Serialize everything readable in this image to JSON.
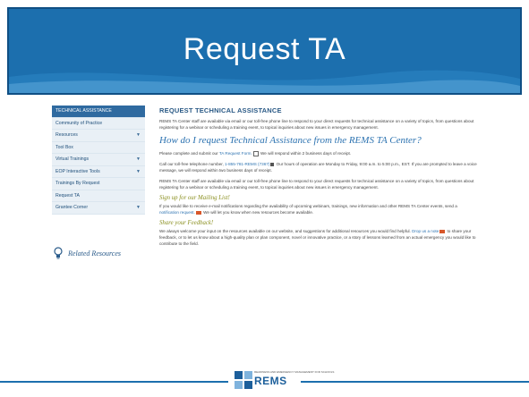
{
  "slide": {
    "title": "Request TA",
    "colors": {
      "header": "#1c6fae",
      "accent": "#2d73b1",
      "subhead": "#8a8f1f"
    }
  },
  "sidebar": {
    "items": [
      {
        "label": "TECHNICAL ASSISTANCE",
        "active": true,
        "has_submenu": false
      },
      {
        "label": "Community of Practice",
        "active": false,
        "has_submenu": false
      },
      {
        "label": "Resources",
        "active": false,
        "has_submenu": true
      },
      {
        "label": "Tool Box",
        "active": false,
        "has_submenu": false
      },
      {
        "label": "Virtual Trainings",
        "active": false,
        "has_submenu": true
      },
      {
        "label": "EOP Interactive Tools",
        "active": false,
        "has_submenu": true
      },
      {
        "label": "Trainings By Request",
        "active": false,
        "has_submenu": false
      },
      {
        "label": "Request TA",
        "active": false,
        "has_submenu": false
      },
      {
        "label": "Grantee Corner",
        "active": false,
        "has_submenu": true
      }
    ],
    "caret": "▼",
    "related_label": "Related Resources"
  },
  "content": {
    "heading": "REQUEST TECHNICAL ASSISTANCE",
    "intro": "REMS TA Center staff are available via email or our toll-free phone line to respond to your direct requests for technical assistance on a variety of topics, from questions about registering for a webinar or scheduling a training event, to topical inquiries about new issues in emergency management.",
    "how_heading": "How do I request Technical Assistance from the REMS TA Center?",
    "form_pre": "Please complete and submit our ",
    "form_link": "TA Request Form.",
    "form_post": " We will respond within 2 business days of receipt.",
    "call_pre": "Call our toll-free telephone number, ",
    "call_link": "1-855-781-REMS (7367)",
    "call_post": " Our hours of operation are Monday to Friday, 9:00 a.m. to 5:00 p.m., EST. If you are prompted to leave a voice message, we will respond within two business days of receipt.",
    "intro2": "REMS TA Center staff are available via email or our toll-free phone line to respond to your direct requests for technical assistance on a variety of topics, from questions about registering for a webinar or scheduling a training event, to topical inquiries about new issues in emergency management.",
    "mailing_heading": "Sign up for our Mailing List!",
    "mailing_pre": "If you would like to receive e-mail notifications regarding the availability of upcoming webinars, trainings, new information and other REMS TA Center events, send a ",
    "mailing_link": "notification request.",
    "mailing_post": " We will let you know when new resources become available.",
    "feedback_heading": "Share your Feedback!",
    "feedback_pre": "We always welcome your input on the resources available on our website, and suggestions for additional resources you would find helpful. ",
    "feedback_link": "Drop us a note",
    "feedback_post": " to share your feedback, or to let us know about a high-quality plan or plan component, novel or innovative practice, or a story of lessons learned from an actual emergency you would like to contribute to the field."
  },
  "logo": {
    "text": "REMS",
    "small": "READINESS AND EMERGENCY MANAGEMENT FOR SCHOOLS"
  }
}
